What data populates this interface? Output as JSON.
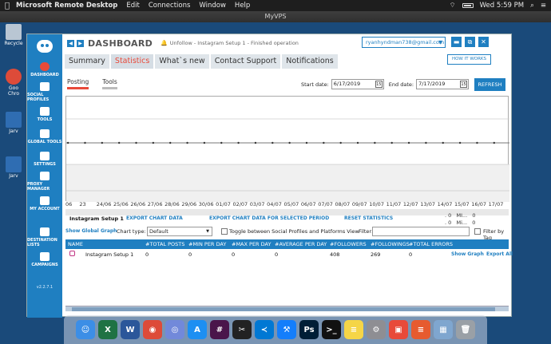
{
  "mac_menubar": {
    "apple": "",
    "app_name": "Microsoft Remote Desktop",
    "menus": [
      "Edit",
      "Connections",
      "Window",
      "Help"
    ],
    "clock": "Wed 5:59 PM",
    "battery_icon": "battery-icon",
    "wifi_icon": "wifi-icon"
  },
  "rdp_window": {
    "title": "MyVPS"
  },
  "desktop_icons": [
    {
      "label": "Recycle",
      "icon": "recycle-bin-icon",
      "color": "#b9c6d3"
    },
    {
      "label": "Goo\nChro",
      "icon": "chrome-icon",
      "color": "#dd4b39"
    },
    {
      "label": "Jarv",
      "icon": "app-icon",
      "color": "#2f6db2"
    },
    {
      "label": "Jarv",
      "icon": "app-icon",
      "color": "#2f6db2"
    }
  ],
  "sidebar": {
    "items": [
      {
        "label": "DASHBOARD",
        "icon": "dashboard-icon",
        "active": true
      },
      {
        "label": "SOCIAL PROFILES",
        "icon": "social-profiles-icon"
      },
      {
        "label": "TOOLS",
        "icon": "tools-icon"
      },
      {
        "label": "GLOBAL TOOLS",
        "icon": "global-tools-icon"
      },
      {
        "label": "SETTINGS",
        "icon": "settings-icon"
      },
      {
        "label": "PROXY MANAGER",
        "icon": "proxy-manager-icon"
      },
      {
        "label": "MY ACCOUNT",
        "icon": "my-account-icon"
      },
      {
        "label": "DESTINATION LISTS",
        "icon": "destination-lists-icon"
      },
      {
        "label": "CAMPAIGNS",
        "icon": "campaigns-icon"
      }
    ],
    "version": "v2.2.7.1"
  },
  "header": {
    "title": "DASHBOARD",
    "status": "Unfollow - Instagram Setup 1 - Finished operation",
    "account": "ryanhyndman738@gmail.com",
    "how_it_works": "HOW IT WORKS"
  },
  "tabs": [
    {
      "label": "Summary",
      "active": false
    },
    {
      "label": "Statistics",
      "active": true
    },
    {
      "label": "What`s new",
      "active": false
    },
    {
      "label": "Contact Support",
      "active": false
    },
    {
      "label": "Notifications",
      "active": false
    }
  ],
  "subtabs": [
    {
      "label": "Posting",
      "active": true
    },
    {
      "label": "Tools",
      "active": false
    }
  ],
  "date_filter": {
    "start_label": "Start date:",
    "start_value": "6/17/2019",
    "end_label": "End date:",
    "end_value": "7/17/2019",
    "calendar_icon": "15",
    "refresh": "REFRESH"
  },
  "chart_data": {
    "type": "line",
    "x": [
      "06",
      "23",
      "24/06",
      "25/06",
      "26/06",
      "27/06",
      "28/06",
      "29/06",
      "30/06",
      "01/07",
      "02/07",
      "03/07",
      "04/07",
      "05/07",
      "06/07",
      "07/07",
      "08/07",
      "09/07",
      "10/07",
      "11/07",
      "12/07",
      "13/07",
      "14/07",
      "15/07",
      "16/07",
      "17/07"
    ],
    "grid": true
  },
  "stats": {
    "account_name": "Instagram Setup 1",
    "export_chart": "EXPORT CHART DATA",
    "export_selected": "EXPORT CHART DATA FOR SELECTED PERIOD",
    "reset": "RESET STATISTICS",
    "summary": [
      ". 0   MI...   0",
      ". 0   Mi...   0"
    ],
    "show_global": "Show Global Graph",
    "chart_type_label": "Chart type:",
    "chart_type_value": "Default",
    "toggle_label": "Toggle between Social Profiles and Platforms View",
    "filter_label": "Filter:",
    "filter_by_tag": "Filter by Tag",
    "columns": [
      "NAME",
      "#TOTAL POSTS",
      "#MIN PER DAY",
      "#MAX PER DAY",
      "#AVERAGE PER DAY",
      "#FOLLOWERS",
      "#FOLLOWINGS",
      "#TOTAL ERRORS"
    ],
    "rows": [
      {
        "name": "Instagram Setup 1",
        "total_posts": "0",
        "min_per_day": "0",
        "max_per_day": "0",
        "avg_per_day": "0",
        "followers": "408",
        "followings": "269",
        "total_errors": "0",
        "show_graph": "Show Graph",
        "export_all": "Export All"
      }
    ]
  },
  "dock": [
    {
      "name": "finder-icon",
      "color": "#3c8ee6",
      "glyph": "☺"
    },
    {
      "name": "excel-icon",
      "color": "#1f7244",
      "glyph": "X"
    },
    {
      "name": "word-icon",
      "color": "#2b579a",
      "glyph": "W"
    },
    {
      "name": "chrome-icon",
      "color": "#dd4b39",
      "glyph": "◉"
    },
    {
      "name": "discord-icon",
      "color": "#7289da",
      "glyph": "◎"
    },
    {
      "name": "app-store-icon",
      "color": "#1d8ff2",
      "glyph": "A"
    },
    {
      "name": "slack-icon",
      "color": "#4a154b",
      "glyph": "#"
    },
    {
      "name": "capcut-icon",
      "color": "#222222",
      "glyph": "✂"
    },
    {
      "name": "vscode-icon",
      "color": "#0078d4",
      "glyph": "≺"
    },
    {
      "name": "xcode-icon",
      "color": "#147efb",
      "glyph": "⚒"
    },
    {
      "name": "photoshop-icon",
      "color": "#001e36",
      "glyph": "Ps"
    },
    {
      "name": "terminal-icon",
      "color": "#111111",
      "glyph": ">_"
    },
    {
      "name": "notes-icon",
      "color": "#f5d547",
      "glyph": "≡"
    },
    {
      "name": "system-preferences-icon",
      "color": "#8e8e93",
      "glyph": "⚙"
    },
    {
      "name": "remote-desktop-icon",
      "color": "#e84a3a",
      "glyph": "▣"
    },
    {
      "name": "reeder-icon",
      "color": "#e65b2f",
      "glyph": "≡"
    },
    {
      "name": "preview-icon",
      "color": "#7fa6cf",
      "glyph": "▦"
    },
    {
      "name": "trash-icon",
      "color": "#9aa0a6",
      "glyph": "🗑"
    }
  ]
}
